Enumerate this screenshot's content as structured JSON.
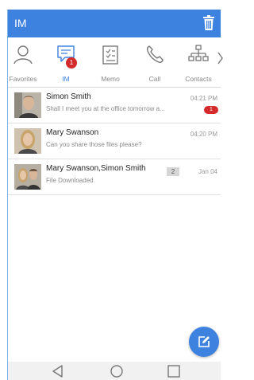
{
  "appbar": {
    "title": "IM"
  },
  "tabs": [
    {
      "id": "favorites",
      "label": "Favorites",
      "icon": "person-icon"
    },
    {
      "id": "im",
      "label": "IM",
      "icon": "chat-icon",
      "badge": "1",
      "active": true
    },
    {
      "id": "memo",
      "label": "Memo",
      "icon": "memo-icon"
    },
    {
      "id": "call",
      "label": "Call",
      "icon": "phone-icon"
    },
    {
      "id": "contacts",
      "label": "Contacts",
      "icon": "org-chart-icon"
    }
  ],
  "conversations": [
    {
      "name": "Simon Smith",
      "message": "Shall I meet you at the office tomorrow a...",
      "time": "04:21 PM",
      "unread": "1"
    },
    {
      "name": "Mary Swanson",
      "message": "Can you share those files please?",
      "time": "04:20 PM"
    },
    {
      "name": "Mary Swanson,Simon Smith",
      "message": "File Downloaded",
      "time": "Jan 04",
      "member_count": "2"
    }
  ],
  "colors": {
    "primary": "#3e82df",
    "badge": "#d32b2b"
  }
}
